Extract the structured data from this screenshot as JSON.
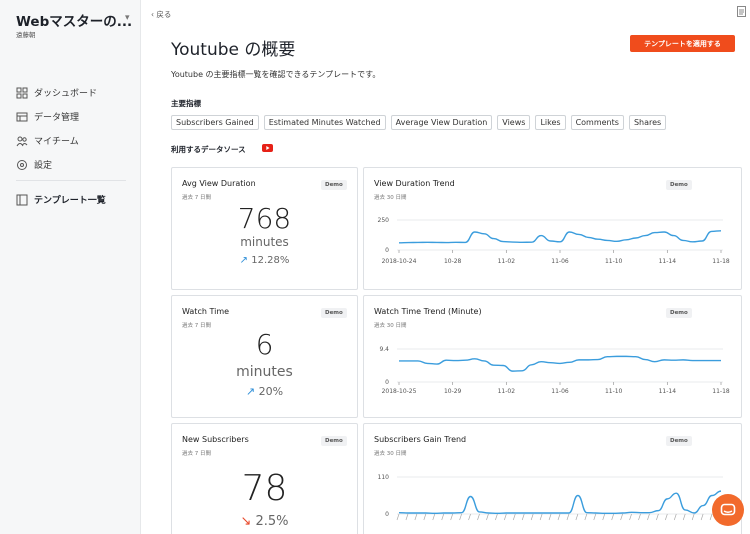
{
  "sidebar": {
    "workspace_title": "Webマスターの...",
    "workspace_sub": "遠藤朝",
    "items": [
      {
        "label": "ダッシュボード"
      },
      {
        "label": "データ管理"
      },
      {
        "label": "マイチーム"
      },
      {
        "label": "設定"
      },
      {
        "label": "テンプレート一覧"
      }
    ]
  },
  "header": {
    "back_label": "戻る",
    "title": "Youtube の概要",
    "apply_button": "テンプレートを適用する",
    "description": "Youtube の主要指標一覧を確認できるテンプレートです。"
  },
  "metrics_section": {
    "label": "主要指標",
    "chips": [
      "Subscribers Gained",
      "Estimated Minutes Watched",
      "Average View Duration",
      "Views",
      "Likes",
      "Comments",
      "Shares"
    ]
  },
  "sources_section": {
    "label": "利用するデータソース",
    "icon": "youtube-icon",
    "color": "#e62117"
  },
  "accent_color": "#f04c1c",
  "cards": {
    "avg_view": {
      "title": "Avg View Duration",
      "sub": "過去 7 日間",
      "demo": "Demo",
      "value": "768",
      "unit": "minutes",
      "delta": "12.28%",
      "trend": "up"
    },
    "watch_time": {
      "title": "Watch Time",
      "sub": "過去 7 日間",
      "demo": "Demo",
      "value": "6",
      "unit": "minutes",
      "delta": "20%",
      "trend": "up"
    },
    "new_subs": {
      "title": "New Subscribers",
      "sub": "過去 7 日間",
      "demo": "Demo",
      "value": "78",
      "delta": "2.5%",
      "trend": "down"
    },
    "view_trend": {
      "title": "View Duration Trend",
      "sub": "過去 30 日間",
      "demo": "Demo"
    },
    "watch_trend": {
      "title": "Watch Time Trend (Minute)",
      "sub": "過去 30 日間",
      "demo": "Demo"
    },
    "subs_trend": {
      "title": "Subscribers Gain Trend",
      "sub": "過去 30 日間",
      "demo": "Demo"
    }
  },
  "chart_data": [
    {
      "type": "line",
      "title": "View Duration Trend",
      "color": "#3b9ddd",
      "ylim": [
        0,
        250
      ],
      "yticks": [
        "0",
        "250"
      ],
      "xticks": [
        "2018-10-24",
        "10-28",
        "11-02",
        "11-06",
        "11-10",
        "11-14",
        "11-18"
      ],
      "values": [
        60,
        62,
        63,
        64,
        63,
        62,
        64,
        63,
        150,
        135,
        95,
        70,
        66,
        64,
        65,
        120,
        75,
        68,
        150,
        130,
        105,
        90,
        80,
        72,
        85,
        100,
        120,
        145,
        150,
        120,
        80,
        68,
        75,
        155,
        160
      ]
    },
    {
      "type": "line",
      "title": "Watch Time Trend (Minute)",
      "color": "#3b9ddd",
      "ylim": [
        0,
        9.4
      ],
      "yticks": [
        "0",
        "9.4"
      ],
      "xticks": [
        "2018-10-25",
        "10-29",
        "11-02",
        "11-06",
        "11-10",
        "11-14",
        "11-18"
      ],
      "values": [
        6,
        6,
        6,
        5.3,
        5.1,
        6.2,
        6.1,
        6.2,
        6.6,
        6,
        4.8,
        4.7,
        3.1,
        3.2,
        4.9,
        5.8,
        5.5,
        5.3,
        5.6,
        6.3,
        6.3,
        6.4,
        7.2,
        7.3,
        7.3,
        7.2,
        6.4,
        5.8,
        6.3,
        6.2,
        6.3,
        6.1,
        6.1,
        6.1,
        6.1
      ]
    },
    {
      "type": "line",
      "title": "Subscribers Gain Trend",
      "color": "#3b9ddd",
      "ylim": [
        0,
        110
      ],
      "yticks": [
        "0",
        "110"
      ],
      "xticks": [],
      "values": [
        4,
        3,
        3,
        3,
        2,
        3,
        3,
        4,
        52,
        6,
        3,
        2,
        3,
        3,
        3,
        3,
        3,
        3,
        3,
        3,
        55,
        4,
        3,
        2,
        2,
        3,
        5,
        4,
        4,
        10,
        45,
        62,
        12,
        3,
        25,
        55,
        68
      ]
    }
  ]
}
